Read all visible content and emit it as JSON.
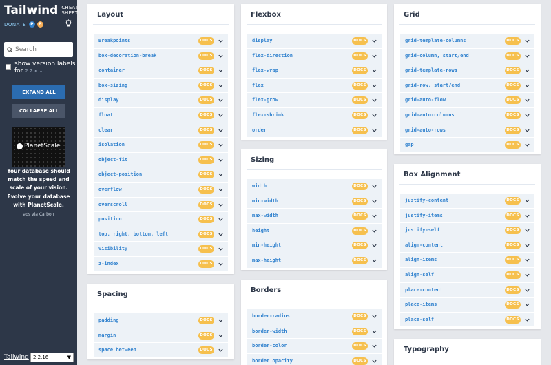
{
  "sidebar": {
    "title": "Tailwind",
    "subtitle_line1": "CHEAT",
    "subtitle_line2": "SHEET",
    "donate": "DONATE",
    "search_placeholder": "Search",
    "version_label_line1": "show version labels",
    "version_label_line2": "for",
    "version_hint": "2.2.x",
    "expand_all": "EXPAND ALL",
    "collapse_all": "COLLAPSE ALL",
    "ad_brand": "PlanetScale",
    "ad_text": "Your database should match the speed and scale of your vision. Evolve your database with PlanetScale.",
    "ad_via": "ads via Carbon",
    "footer_link": "Tailwind",
    "footer_version": "2.2.16"
  },
  "docs_label": "DOCS",
  "cards": {
    "layout": {
      "title": "Layout",
      "items": [
        "Breakpoints",
        "box-decoration-break",
        "container",
        "box-sizing",
        "display",
        "float",
        "clear",
        "isolation",
        "object-fit",
        "object-position",
        "overflow",
        "overscroll",
        "position",
        "top, right, bottom, left",
        "visibility",
        "z-index"
      ]
    },
    "spacing": {
      "title": "Spacing",
      "items": [
        "padding",
        "margin",
        "space between"
      ]
    },
    "flexbox": {
      "title": "Flexbox",
      "items": [
        "display",
        "flex-direction",
        "flex-wrap",
        "flex",
        "flex-grow",
        "flex-shrink",
        "order"
      ]
    },
    "sizing": {
      "title": "Sizing",
      "items": [
        "width",
        "min-width",
        "max-width",
        "height",
        "min-height",
        "max-height"
      ]
    },
    "borders": {
      "title": "Borders",
      "items": [
        "border-radius",
        "border-width",
        "border-color",
        "border opacity"
      ]
    },
    "grid": {
      "title": "Grid",
      "items": [
        "grid-template-columns",
        "grid-column, start/end",
        "grid-template-rows",
        "grid-row, start/end",
        "grid-auto-flow",
        "grid-auto-columns",
        "grid-auto-rows",
        "gap"
      ]
    },
    "box_alignment": {
      "title": "Box Alignment",
      "items": [
        "justify-content",
        "justify-items",
        "justify-self",
        "align-content",
        "align-items",
        "align-self",
        "place-content",
        "place-items",
        "place-self"
      ]
    },
    "typography": {
      "title": "Typography",
      "items": []
    }
  }
}
